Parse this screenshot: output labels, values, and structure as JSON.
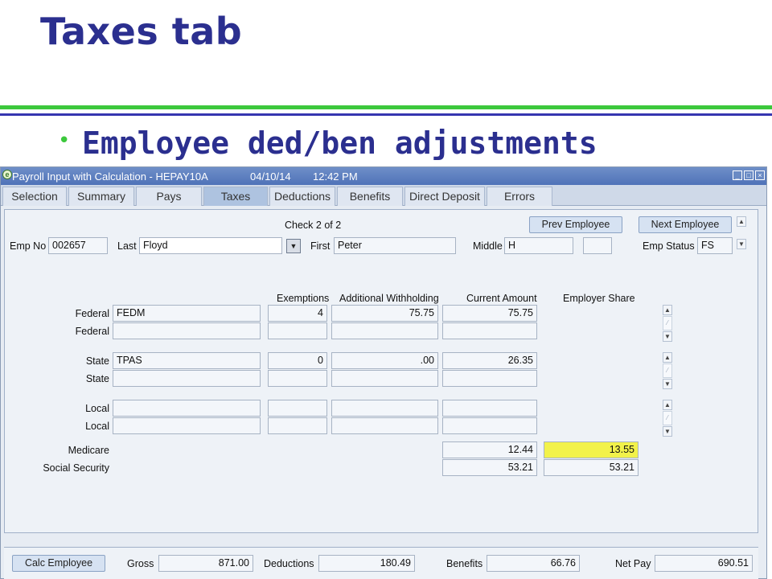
{
  "slide": {
    "title": "Taxes tab",
    "bullet": "Employee ded/ben adjustments"
  },
  "window": {
    "title": "Payroll Input with Calculation - HEPAY10A",
    "date": "04/10/14",
    "time": "12:42 PM"
  },
  "tabs": [
    "Selection",
    "Summary",
    "Pays",
    "Taxes",
    "Deductions",
    "Benefits",
    "Direct Deposit",
    "Errors"
  ],
  "active_tab": "Taxes",
  "header": {
    "check_label": "Check 2 of 2",
    "prev_employee": "Prev Employee",
    "next_employee": "Next Employee",
    "emp_no_label": "Emp No",
    "emp_no": "002657",
    "last_label": "Last",
    "last": "Floyd",
    "first_label": "First",
    "first": "Peter",
    "middle_label": "Middle",
    "middle": "H",
    "extra": "",
    "emp_status_label": "Emp Status",
    "emp_status": "FS"
  },
  "columns": {
    "exemptions": "Exemptions",
    "additional": "Additional Withholding",
    "current": "Current Amount",
    "employer": "Employer Share"
  },
  "tax_rows": [
    {
      "label": "Federal",
      "code": "FEDM",
      "exemptions": "4",
      "additional": "75.75",
      "current": "75.75"
    },
    {
      "label": "Federal",
      "code": "",
      "exemptions": "",
      "additional": "",
      "current": ""
    },
    {
      "label": "State",
      "code": "TPAS",
      "exemptions": "0",
      "additional": ".00",
      "current": "26.35"
    },
    {
      "label": "State",
      "code": "",
      "exemptions": "",
      "additional": "",
      "current": ""
    },
    {
      "label": "Local",
      "code": "",
      "exemptions": "",
      "additional": "",
      "current": ""
    },
    {
      "label": "Local",
      "code": "",
      "exemptions": "",
      "additional": "",
      "current": ""
    }
  ],
  "medicare": {
    "label": "Medicare",
    "current": "12.44",
    "employer": "13.55"
  },
  "social_security": {
    "label": "Social Security",
    "current": "53.21",
    "employer": "53.21"
  },
  "footer": {
    "calc_button": "Calc Employee",
    "gross_label": "Gross",
    "gross": "871.00",
    "deductions_label": "Deductions",
    "deductions": "180.49",
    "benefits_label": "Benefits",
    "benefits": "66.76",
    "net_pay_label": "Net Pay",
    "net_pay": "690.51"
  },
  "colors": {
    "title": "#2b2f8f",
    "accent_green": "#3cc83c",
    "highlight": "#f2f24a"
  }
}
